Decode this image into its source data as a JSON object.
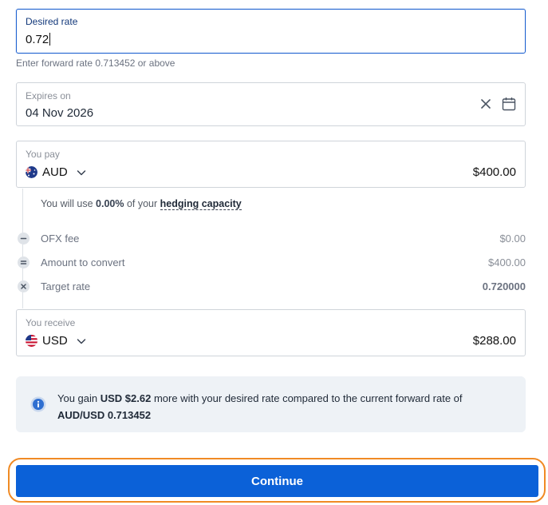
{
  "rate": {
    "label": "Desired rate",
    "value": "0.72",
    "helper": "Enter forward rate 0.713452 or above"
  },
  "expiry": {
    "label": "Expires on",
    "value": "04 Nov 2026"
  },
  "pay": {
    "label": "You pay",
    "currency": "AUD",
    "amount": "$400.00"
  },
  "capacity": {
    "prefix": "You will use ",
    "percent": "0.00%",
    "middle": " of your ",
    "link": "hedging capacity"
  },
  "breakdown": [
    {
      "label": "OFX fee",
      "value": "$0.00"
    },
    {
      "label": "Amount to convert",
      "value": "$400.00"
    },
    {
      "label": "Target rate",
      "value": "0.720000"
    }
  ],
  "receive": {
    "label": "You receive",
    "currency": "USD",
    "amount": "$288.00"
  },
  "info": {
    "t1": "You gain ",
    "gain": "USD $2.62",
    "t2": " more with your desired rate compared to the current forward rate of ",
    "pair": "AUD/USD 0.713452"
  },
  "continue_label": "Continue",
  "colors": {
    "accent": "#0b61d8",
    "focus_ring": "#f08a24",
    "info_bg": "#eef2f6"
  }
}
